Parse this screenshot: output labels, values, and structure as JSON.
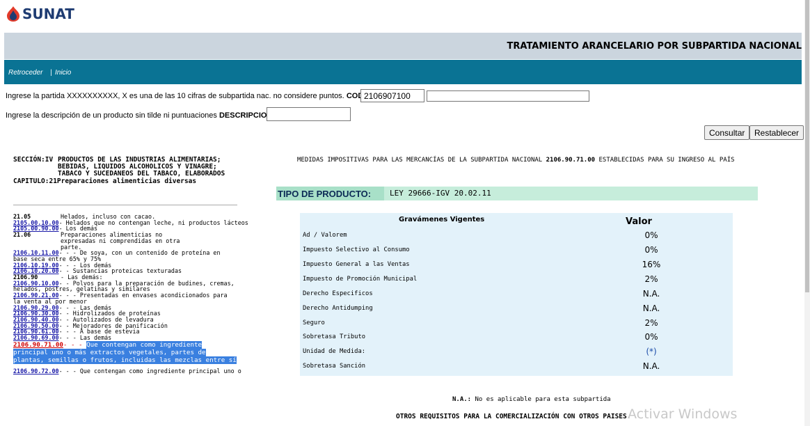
{
  "brand": {
    "logo_text": "SUNAT"
  },
  "page_title": "TRATAMIENTO ARANCELARIO POR SUBPARTIDA NACIONAL",
  "nav": {
    "back": "Retroceder",
    "sep": "|",
    "home": "Inicio"
  },
  "form": {
    "code_prompt": "Ingrese la partida XXXXXXXXXX, X es una de las 10 cifras de subpartida nac. no considere puntos.",
    "code_label": "CODIGO :",
    "code_value": "2106907100",
    "code_extra_value": "",
    "desc_prompt": "Ingrese la descripción de un producto sin tilde ni puntuaciones",
    "desc_label": "DESCRIPCION :",
    "desc_value": "",
    "consultar": "Consultar",
    "restablecer": "Restablecer"
  },
  "section": {
    "seccion_label": "SECCIÓN:IV",
    "seccion_text": "PRODUCTOS DE LAS INDUSTRIAS ALIMENTARIAS; BEBIDAS, LIQUIDOS ALCOHOLICOS Y VINAGRE; TABACO Y SUCEDANEOS DEL TABACO, ELABORADOS",
    "capitulo_label": "CAPITULO:21",
    "capitulo_text": "Preparaciones alimenticias diversas"
  },
  "tree": [
    {
      "code": "21.05",
      "text": "Helados, incluso con cacao.",
      "kind": "hdr"
    },
    {
      "code": "2105.00.10.00",
      "text": "- Helados que no contengan leche, ni productos lácteos",
      "kind": "link"
    },
    {
      "code": "2105.00.90.00",
      "text": "- Los demás",
      "kind": "link"
    },
    {
      "code": "21.06",
      "text": "Preparaciones alimenticias no expresadas ni comprendidas en otra parte.",
      "kind": "hdr"
    },
    {
      "code": "2106.10.11.00",
      "text": "- - - De soya, con un contenido de proteína en base seca entre 65% y 75%",
      "kind": "link"
    },
    {
      "code": "2106.10.19.00",
      "text": "- - - Los demás",
      "kind": "link"
    },
    {
      "code": "2106.10.20.00",
      "text": "- - Sustancias proteicas texturadas",
      "kind": "link"
    },
    {
      "code": "2106.90",
      "text": "- Las demás:",
      "kind": "hdr"
    },
    {
      "code": "2106.90.10.00",
      "text": "- - Polvos para la preparación de budines, cremas, helados, postres, gelatinas y similares",
      "kind": "link"
    },
    {
      "code": "2106.90.21.00",
      "text": "- - - Presentadas en envases acondicionados para la venta al por menor",
      "kind": "link"
    },
    {
      "code": "2106.90.29.00",
      "text": "- - - Las demás",
      "kind": "link"
    },
    {
      "code": "2106.90.30.00",
      "text": "- - Hidrolizados de proteínas",
      "kind": "link"
    },
    {
      "code": "2106.90.40.00",
      "text": "- - Autolizados de levadura",
      "kind": "link"
    },
    {
      "code": "2106.90.50.00",
      "text": "- - Mejoradores de panificación",
      "kind": "link"
    },
    {
      "code": "2106.90.61.00",
      "text": "- - - A base de estevia",
      "kind": "link"
    },
    {
      "code": "2106.90.69.00",
      "text": "- - - Las demás",
      "kind": "link"
    },
    {
      "code": "2106.90.71.00",
      "prefix": "- - - ",
      "text": "Que contengan como ingrediente principal uno o más extractos vegetales, partes de plantas, semillas o frutos, incluidas las mezclas entre sí",
      "kind": "selected"
    },
    {
      "code": "2106.90.72.00",
      "text": "- - - Que contengan como ingrediente principal uno o",
      "kind": "link"
    }
  ],
  "medidas": {
    "prefix": "MEDIDAS IMPOSITIVAS PARA LAS MERCANCÍAS DE LA SUBPARTIDA NACIONAL",
    "code": "2106.90.71.00",
    "suffix": "ESTABLECIDAS PARA SU INGRESO AL PAÍS"
  },
  "tipo_producto": {
    "label": "TIPO DE PRODUCTO:",
    "value": "LEY 29666-IGV 20.02.11"
  },
  "gravamenes": {
    "header_name": "Gravámenes Vigentes",
    "header_value": "Valor",
    "rows": [
      {
        "name": "Ad / Valorem",
        "value": "0%"
      },
      {
        "name": "Impuesto Selectivo al Consumo",
        "value": "0%"
      },
      {
        "name": "Impuesto General a las Ventas",
        "value": "16%"
      },
      {
        "name": "Impuesto de Promoción Municipal",
        "value": "2%"
      },
      {
        "name": "Derecho Especificos",
        "value": "N.A."
      },
      {
        "name": "Derecho Antidumping",
        "value": "N.A."
      },
      {
        "name": "Seguro",
        "value": "2%"
      },
      {
        "name": "Sobretasa Tributo",
        "value": "0%"
      },
      {
        "name": "Unidad de Medida:",
        "value": "(*)",
        "link": true
      },
      {
        "name": "Sobretasa Sanción",
        "value": "N.A."
      }
    ]
  },
  "na_note": {
    "label": "N.A.:",
    "text": "No es aplicable para esta subpartida"
  },
  "otros": "OTROS REQUISITOS PARA LA COMERCIALIZACIÓN CON OTROS PAISES.",
  "watermark": "Activar Windows"
}
